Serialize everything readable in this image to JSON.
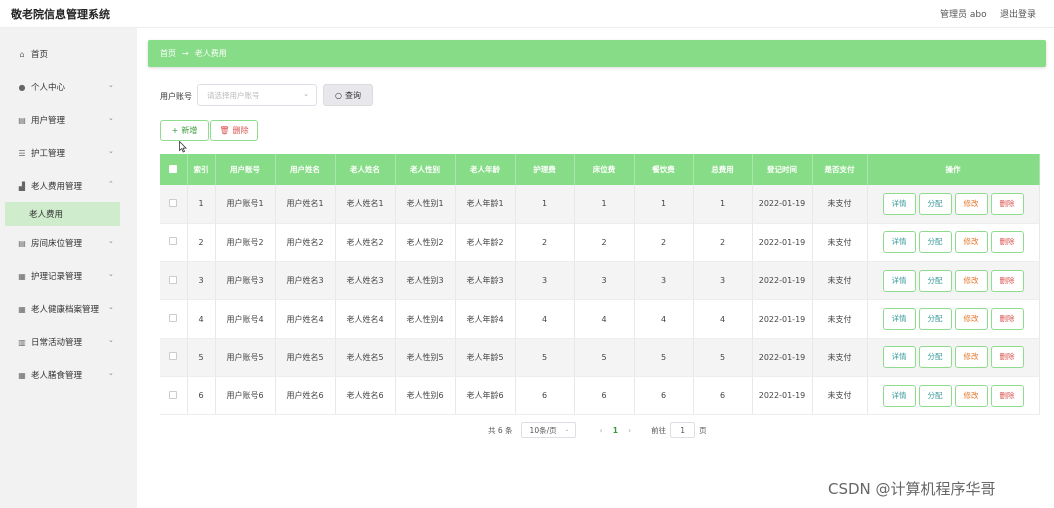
{
  "header": {
    "title": "敬老院信息管理系统",
    "user": "管理员 abo",
    "logout": "退出登录"
  },
  "sidebar": {
    "items": [
      {
        "label": "首页",
        "icon": "home-icon",
        "glyph": "⌂",
        "chevron": false
      },
      {
        "label": "个人中心",
        "icon": "user-icon",
        "glyph": "●",
        "chevron": true
      },
      {
        "label": "用户管理",
        "icon": "document-icon",
        "glyph": "▤",
        "chevron": true
      },
      {
        "label": "护工管理",
        "icon": "list-icon",
        "glyph": "☰",
        "chevron": true
      },
      {
        "label": "老人费用管理",
        "icon": "chart-icon",
        "glyph": "▟",
        "chevron": true
      },
      {
        "label": "房间床位管理",
        "icon": "document-icon",
        "glyph": "▤",
        "chevron": true
      },
      {
        "label": "护理记录管理",
        "icon": "grid-icon",
        "glyph": "▦",
        "chevron": true
      },
      {
        "label": "老人健康档案管理",
        "icon": "grid-icon",
        "glyph": "▦",
        "chevron": true
      },
      {
        "label": "日常活动管理",
        "icon": "bar-chart-icon",
        "glyph": "▥",
        "chevron": true
      },
      {
        "label": "老人膳食管理",
        "icon": "grid-icon",
        "glyph": "▦",
        "chevron": true
      }
    ],
    "active_sub": "老人费用"
  },
  "breadcrumb": {
    "home": "首页",
    "arrow": "→",
    "current": "老人费用"
  },
  "search": {
    "label": "用户账号",
    "placeholder": "请选择用户账号",
    "chevron": "⌄",
    "query_icon": "○",
    "query_label": "查询"
  },
  "actions": {
    "add_icon": "+",
    "add_label": "新增",
    "delete_icon": "🗑",
    "delete_label": "删除"
  },
  "table": {
    "columns": [
      "",
      "索引",
      "用户账号",
      "用户姓名",
      "老人姓名",
      "老人性别",
      "老人年龄",
      "护理费",
      "床位费",
      "餐饮费",
      "总费用",
      "登记时间",
      "是否支付",
      "操作"
    ],
    "rows": [
      {
        "index": "1",
        "account": "用户账号1",
        "user_name": "用户姓名1",
        "elder_name": "老人姓名1",
        "gender": "老人性别1",
        "age": "老人年龄1",
        "care_fee": "1",
        "bed_fee": "1",
        "meal_fee": "1",
        "total": "1",
        "date": "2022-01-19",
        "paid": "未支付"
      },
      {
        "index": "2",
        "account": "用户账号2",
        "user_name": "用户姓名2",
        "elder_name": "老人姓名2",
        "gender": "老人性别2",
        "age": "老人年龄2",
        "care_fee": "2",
        "bed_fee": "2",
        "meal_fee": "2",
        "total": "2",
        "date": "2022-01-19",
        "paid": "未支付"
      },
      {
        "index": "3",
        "account": "用户账号3",
        "user_name": "用户姓名3",
        "elder_name": "老人姓名3",
        "gender": "老人性别3",
        "age": "老人年龄3",
        "care_fee": "3",
        "bed_fee": "3",
        "meal_fee": "3",
        "total": "3",
        "date": "2022-01-19",
        "paid": "未支付"
      },
      {
        "index": "4",
        "account": "用户账号4",
        "user_name": "用户姓名4",
        "elder_name": "老人姓名4",
        "gender": "老人性别4",
        "age": "老人年龄4",
        "care_fee": "4",
        "bed_fee": "4",
        "meal_fee": "4",
        "total": "4",
        "date": "2022-01-19",
        "paid": "未支付"
      },
      {
        "index": "5",
        "account": "用户账号5",
        "user_name": "用户姓名5",
        "elder_name": "老人姓名5",
        "gender": "老人性别5",
        "age": "老人年龄5",
        "care_fee": "5",
        "bed_fee": "5",
        "meal_fee": "5",
        "total": "5",
        "date": "2022-01-19",
        "paid": "未支付"
      },
      {
        "index": "6",
        "account": "用户账号6",
        "user_name": "用户姓名6",
        "elder_name": "老人姓名6",
        "gender": "老人性别6",
        "age": "老人年龄6",
        "care_fee": "6",
        "bed_fee": "6",
        "meal_fee": "6",
        "total": "6",
        "date": "2022-01-19",
        "paid": "未支付"
      }
    ],
    "row_actions": {
      "detail": "详情",
      "assign": "分配",
      "edit": "修改",
      "delete": "删除"
    }
  },
  "pagination": {
    "total": "共 6 条",
    "page_size": "10条/页",
    "prev": "‹",
    "current": "1",
    "next": "›",
    "goto_label": "前往",
    "goto_value": "1",
    "page_suffix": "页"
  },
  "watermark": "CSDN @计算机程序华哥",
  "colors": {
    "accent": "#87dd87",
    "active_menu": "#cfeccc",
    "sidebar": "#f2f2f2"
  }
}
